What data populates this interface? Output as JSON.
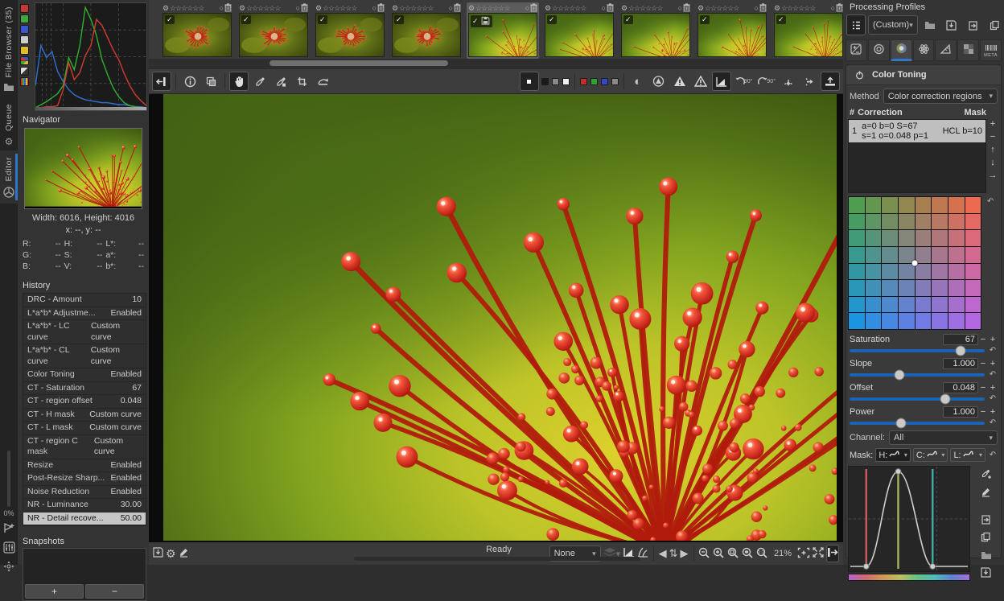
{
  "app": {
    "accent": "#2f76c9",
    "bg": "#2e2e2e"
  },
  "left_tabbar": {
    "tabs": [
      {
        "label": "File Browser (35)",
        "icon": "folder-icon",
        "active": false
      },
      {
        "label": "Queue",
        "icon": "gears-icon",
        "active": false
      },
      {
        "label": "Editor",
        "icon": "aperture-icon",
        "active": true
      }
    ],
    "zoom_percent": "0%",
    "bottom_icons": [
      "add-quick-profile-icon",
      "mixer-icon",
      "move-icon"
    ]
  },
  "histogram": {
    "buttons": [
      {
        "name": "red-channel",
        "color": "#c33b35"
      },
      {
        "name": "green-channel",
        "color": "#3fa83f"
      },
      {
        "name": "blue-channel",
        "color": "#3a57cc"
      },
      {
        "name": "luminosity",
        "color": "#cccccc"
      },
      {
        "name": "chroma",
        "color": "#e0bd27"
      },
      {
        "name": "working-profile",
        "color": "mosaic"
      },
      {
        "name": "raw-histogram",
        "color": "half"
      },
      {
        "name": "bar-mode",
        "color": "bars"
      }
    ],
    "curves": {
      "red": [
        0,
        0,
        0.01,
        0.01,
        0.02,
        0.18,
        0.45,
        0.28,
        0.35,
        0.52,
        0.62,
        0.88,
        0.82,
        0.7,
        0.58,
        0.48,
        0.34,
        0.22,
        0.13,
        0.07,
        0.02
      ],
      "green": [
        0,
        0.03,
        0.06,
        0.1,
        0.14,
        0.22,
        0.5,
        0.38,
        0.62,
        1.0,
        0.88,
        0.72,
        0.48,
        0.33,
        0.2,
        0.11,
        0.05,
        0.02,
        0.01,
        0,
        0
      ],
      "blue": [
        0.22,
        0.62,
        0.5,
        0.56,
        0.36,
        0.26,
        0.18,
        0.13,
        0.1,
        0.08,
        0.07,
        0.06,
        0.05,
        0.05,
        0.04,
        0.03,
        0.03,
        0.02,
        0.01,
        0.01,
        0
      ]
    },
    "curve_colors": {
      "red": "#d23a2e",
      "green": "#2fae2f",
      "blue": "#2f6fd2"
    }
  },
  "navigator": {
    "title": "Navigator",
    "size_info": "Width: 6016, Height: 4016",
    "coords": "x: --, y: --",
    "values": [
      [
        {
          "k": "R:",
          "v": "--"
        },
        {
          "k": "H:",
          "v": "--"
        },
        {
          "k": "L*:",
          "v": "--"
        }
      ],
      [
        {
          "k": "G:",
          "v": "--"
        },
        {
          "k": "S:",
          "v": "--"
        },
        {
          "k": "a*:",
          "v": "--"
        }
      ],
      [
        {
          "k": "B:",
          "v": "--"
        },
        {
          "k": "V:",
          "v": "--"
        },
        {
          "k": "b*:",
          "v": "--"
        }
      ]
    ]
  },
  "history": {
    "title": "History",
    "items": [
      {
        "name": "DRC - Amount",
        "value": "10",
        "selected": false
      },
      {
        "name": "L*a*b* Adjustme...",
        "value": "Enabled",
        "selected": false
      },
      {
        "name": "L*a*b* - LC curve",
        "value": "Custom curve",
        "selected": false
      },
      {
        "name": "L*a*b* - CL curve",
        "value": "Custom curve",
        "selected": false
      },
      {
        "name": "Color Toning",
        "value": "Enabled",
        "selected": false
      },
      {
        "name": "CT - Saturation",
        "value": "67",
        "selected": false
      },
      {
        "name": "CT - region offset",
        "value": "0.048",
        "selected": false
      },
      {
        "name": "CT - H mask",
        "value": "Custom curve",
        "selected": false
      },
      {
        "name": "CT - L mask",
        "value": "Custom curve",
        "selected": false
      },
      {
        "name": "CT - region C mask",
        "value": "Custom curve",
        "selected": false
      },
      {
        "name": "Resize",
        "value": "Enabled",
        "selected": false
      },
      {
        "name": "Post-Resize Sharp...",
        "value": "Enabled",
        "selected": false
      },
      {
        "name": "Noise Reduction",
        "value": "Enabled",
        "selected": false
      },
      {
        "name": "NR - Luminance",
        "value": "30.00",
        "selected": false
      },
      {
        "name": "NR - Detail recove...",
        "value": "50.00",
        "selected": true
      }
    ]
  },
  "snapshots": {
    "title": "Snapshots",
    "add_label": "+",
    "remove_label": "−"
  },
  "filmstrip": {
    "star_count": 6,
    "header_icons": [
      "profile-gear-icon",
      "rank-stars",
      "color-label-icon",
      "trash-icon"
    ],
    "thumbnails": [
      {
        "variant": "wide",
        "selected": false,
        "saved": false
      },
      {
        "variant": "wide",
        "selected": false,
        "saved": false
      },
      {
        "variant": "wide",
        "selected": false,
        "saved": false
      },
      {
        "variant": "wide",
        "selected": false,
        "saved": false
      },
      {
        "variant": "macro",
        "selected": true,
        "saved": true
      },
      {
        "variant": "macro",
        "selected": false,
        "saved": false
      },
      {
        "variant": "macro",
        "selected": false,
        "saved": false
      },
      {
        "variant": "macro",
        "selected": false,
        "saved": false
      },
      {
        "variant": "macro",
        "selected": false,
        "saved": false
      }
    ]
  },
  "toolbar": {
    "left": [
      {
        "name": "collapse-filmstrip",
        "pressed": true
      },
      {
        "name": "image-info",
        "pressed": false
      },
      {
        "name": "before-after-view",
        "pressed": false
      },
      {
        "name": "hand-tool",
        "pressed": true
      },
      {
        "name": "color-picker",
        "pressed": false
      },
      {
        "name": "lockable-color-picker",
        "pressed": false
      },
      {
        "name": "crop-tool",
        "pressed": false
      },
      {
        "name": "straighten-tool",
        "pressed": false
      }
    ],
    "bg_colors": [
      "#1a1a1a",
      "#8a8a8a",
      "#f2f2f2"
    ],
    "channel_squares": [
      "#c03028",
      "#2fa32f",
      "#3448c8",
      "#8a8a8a"
    ],
    "right": [
      {
        "name": "bw-preview",
        "pressed": false
      },
      {
        "name": "sharpen-mask-preview",
        "pressed": false
      },
      {
        "name": "shadow-clip-warning",
        "pressed": false
      },
      {
        "name": "highlight-clip-warning",
        "pressed": false
      },
      {
        "name": "preview-profile",
        "pressed": true
      },
      {
        "name": "rotate-left-90",
        "pressed": false,
        "label": "90°"
      },
      {
        "name": "rotate-right-90",
        "pressed": false,
        "label": "90°"
      },
      {
        "name": "perspective-vertical",
        "pressed": false
      },
      {
        "name": "perspective-horizontal",
        "pressed": false
      },
      {
        "name": "collapse-top-panel",
        "pressed": true
      }
    ]
  },
  "statusbar": {
    "left_icons": [
      "save-image-icon",
      "add-to-queue-icon",
      "edit-external-icon"
    ],
    "status": "Ready",
    "profile_select_value": "None",
    "mid_icons": [
      "preview-mode-icon",
      "snapshot-icon",
      "guides-icon"
    ],
    "nav_icons": [
      "prev-image-icon",
      "swap-images-icon",
      "next-image-icon"
    ],
    "zoom_icons": [
      "zoom-out-icon",
      "zoom-in-icon",
      "zoom-fit-icon",
      "zoom-fit-crop-icon",
      "zoom-100-icon"
    ],
    "zoom_value": "21%",
    "right_icons": [
      "detail-window-icon",
      "fullscreen-icon",
      "collapse-right-panel-icon"
    ]
  },
  "right_panel": {
    "processing_profiles": {
      "title": "Processing Profiles",
      "selected": "(Custom)",
      "icons": [
        "fill-mode-icon",
        "open-profile-icon",
        "save-profile-icon",
        "paste-profile-icon",
        "copy-profile-icon"
      ]
    },
    "tool_tabs": [
      {
        "name": "exposure-tab",
        "active": false
      },
      {
        "name": "detail-tab",
        "active": false
      },
      {
        "name": "color-tab",
        "active": true
      },
      {
        "name": "advanced-tab",
        "active": false
      },
      {
        "name": "transform-tab",
        "active": false
      },
      {
        "name": "raw-tab",
        "active": false
      },
      {
        "name": "metadata-tab",
        "active": false,
        "label": "META"
      }
    ],
    "color_toning": {
      "title": "Color Toning",
      "method_label": "Method",
      "method_value": "Color correction regions",
      "list_header": {
        "num": "#",
        "correction": "Correction",
        "mask": "Mask"
      },
      "rows": [
        {
          "num": "1",
          "line1": "a=0 b=0 S=67",
          "line2": "s=1 o=0.048 p=1",
          "mask": "HCL b=10",
          "selected": true
        }
      ],
      "list_buttons": [
        {
          "name": "add-region",
          "glyph": "+"
        },
        {
          "name": "remove-region",
          "glyph": "−"
        },
        {
          "name": "move-up",
          "glyph": "↑"
        },
        {
          "name": "move-down",
          "glyph": "↓"
        },
        {
          "name": "duplicate-region",
          "glyph": "→"
        }
      ],
      "grid_corners": {
        "tl": "#47a244",
        "tr": "#fb6645",
        "bl": "#0c97ec",
        "br": "#bb64ee"
      },
      "sliders": [
        {
          "label": "Saturation",
          "value": "67",
          "pos": 0.82
        },
        {
          "label": "Slope",
          "value": "1.000",
          "pos": 0.37
        },
        {
          "label": "Offset",
          "value": "0.048",
          "pos": 0.71
        },
        {
          "label": "Power",
          "value": "1.000",
          "pos": 0.38
        }
      ],
      "channel_label": "Channel:",
      "channel_value": "All",
      "mask_label": "Mask:",
      "mask_curves": [
        {
          "label": "H:",
          "pressed": true
        },
        {
          "label": "C:",
          "pressed": false
        },
        {
          "label": "L:",
          "pressed": false
        }
      ],
      "mask_chart": {
        "type": "area",
        "points": [
          [
            0,
            0
          ],
          [
            0.145,
            0.02
          ],
          [
            0.41,
            1.0
          ],
          [
            0.695,
            0.02
          ],
          [
            1,
            0
          ]
        ],
        "vlines": [
          {
            "x": 0.145,
            "color": "#c85f5f"
          },
          {
            "x": 0.41,
            "color": "#a9b257"
          },
          {
            "x": 0.695,
            "color": "#3fae9f"
          }
        ],
        "dashed_v": 0.73,
        "dashed_h": 0.5
      },
      "curve_icons_top": [
        "pick-color-icon",
        "edit-points-icon"
      ],
      "curve_icons_bottom": [
        "paste-curve-icon",
        "copy-curve-icon",
        "load-curve-icon",
        "save-curve-icon"
      ]
    }
  }
}
